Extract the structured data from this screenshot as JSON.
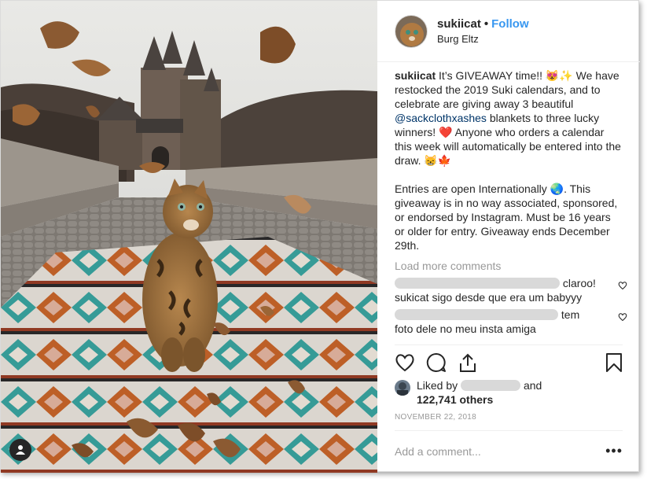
{
  "header": {
    "username": "sukiicat",
    "separator": "•",
    "follow_label": "Follow",
    "location": "Burg Eltz"
  },
  "caption": {
    "username": "sukiicat",
    "text_1": " It’s GIVEAWAY time!! 😻✨ We have restocked the 2019 Suki calendars, and to celebrate are giving away 3 beautiful ",
    "mention": "@sackclothxashes",
    "text_2": " blankets to three lucky winners! ❤️ Anyone who orders a calendar this week will automatically be entered into the draw. 😸🍁\n\nEntries are open Internationally 🌏. This giveaway is in no way associated, sponsored, or endorsed by Instagram. Must be 16 years or older for entry. Giveaway ends December 29th."
  },
  "load_more_label": "Load more comments",
  "comments": [
    {
      "visible_text_1": "claroo!",
      "visible_text_2": "sukicat sigo desde que era um babyyy"
    },
    {
      "visible_text_1": "tem",
      "visible_text_2": "foto dele no meu insta amiga"
    }
  ],
  "likes": {
    "liked_by": "Liked by",
    "and": "and",
    "count_label": "122,741 others"
  },
  "date": "NOVEMBER 22, 2018",
  "add_comment": {
    "placeholder": "Add a comment..."
  },
  "more_options": "•••",
  "icons": {
    "like": "heart-icon",
    "comment": "comment-icon",
    "share": "share-icon",
    "save": "bookmark-icon",
    "user_tag": "person-icon"
  },
  "colors": {
    "accent": "#3897f0",
    "mention": "#003569",
    "muted": "#999999",
    "text": "#262626"
  }
}
